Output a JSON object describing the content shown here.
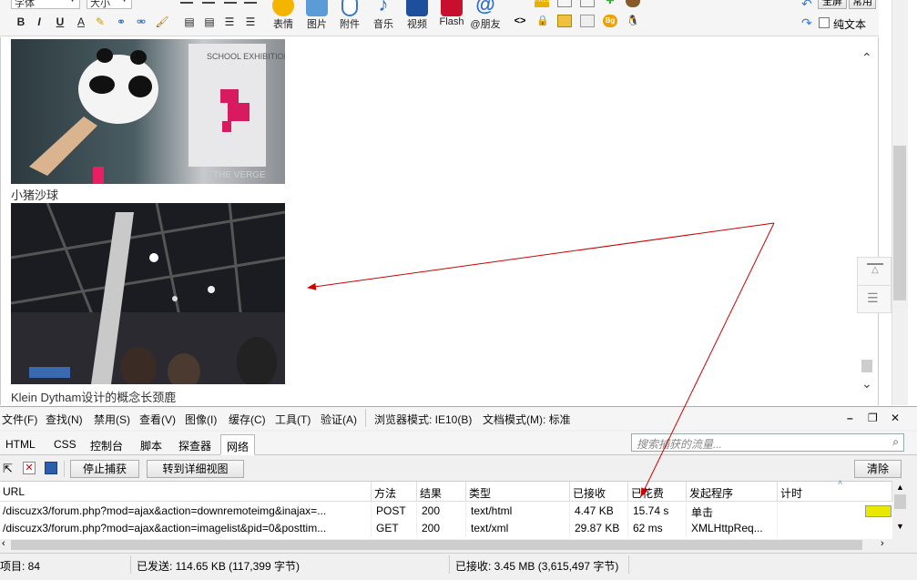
{
  "toolbar": {
    "font_select": "字体",
    "size_select": "大小",
    "format_buttons": [
      "B",
      "I",
      "U",
      "A"
    ],
    "big_buttons": [
      {
        "label": "表情",
        "icon": "smiley-icon"
      },
      {
        "label": "图片",
        "icon": "image-icon"
      },
      {
        "label": "附件",
        "icon": "paperclip-icon"
      },
      {
        "label": "音乐",
        "icon": "music-note-icon"
      },
      {
        "label": "视频",
        "icon": "video-icon"
      },
      {
        "label": "Flash",
        "icon": "flash-icon"
      },
      {
        "label": "@朋友",
        "icon": "at-icon"
      }
    ],
    "fullscreen_label": "全屏",
    "common_label": "常用",
    "plaintext_label": "纯文本",
    "code_label": "<>",
    "bg_label": "Bg"
  },
  "editor": {
    "caption1": "小猪沙球",
    "caption2": "Klein Dytham设计的概念长颈鹿",
    "photo1_text": "SCHOOL EXHIBITION",
    "photo1_watermark": "THE VERGE"
  },
  "devtools": {
    "menu": [
      "文件(F)",
      "查找(N)",
      "禁用(S)",
      "查看(V)",
      "图像(I)",
      "缓存(C)",
      "工具(T)",
      "验证(A)",
      "浏览器模式: IE10(B)",
      "文档模式(M): 标准"
    ],
    "tabs": [
      "HTML",
      "CSS",
      "控制台",
      "脚本",
      "探查器",
      "网络"
    ],
    "active_tab": "网络",
    "search_placeholder": "搜索捕获的流量...",
    "stop_capture": "停止捕获",
    "detail_view": "转到详细视图",
    "clear": "清除",
    "columns": [
      "URL",
      "方法",
      "结果",
      "类型",
      "已接收",
      "已花费",
      "发起程序",
      "计时"
    ],
    "rows": [
      {
        "url": "/discuzx3/forum.php?mod=ajax&action=downremoteimg&inajax=...",
        "method": "POST",
        "result": "200",
        "type": "text/html",
        "received": "4.47 KB",
        "taken": "15.74 s",
        "initiator": "单击"
      },
      {
        "url": "/discuzx3/forum.php?mod=ajax&action=imagelist&pid=0&posttim...",
        "method": "GET",
        "result": "200",
        "type": "text/xml",
        "received": "29.87 KB",
        "taken": "62 ms",
        "initiator": "XMLHttpReq..."
      }
    ],
    "status": {
      "items": "项目: 84",
      "sent": "已发送: 114.65 KB (117,399 字节)",
      "received": "已接收: 3.45 MB (3,615,497 字节)"
    }
  },
  "colors": {
    "arrow": "#cc0000",
    "timing_bar": "#e8e800"
  }
}
